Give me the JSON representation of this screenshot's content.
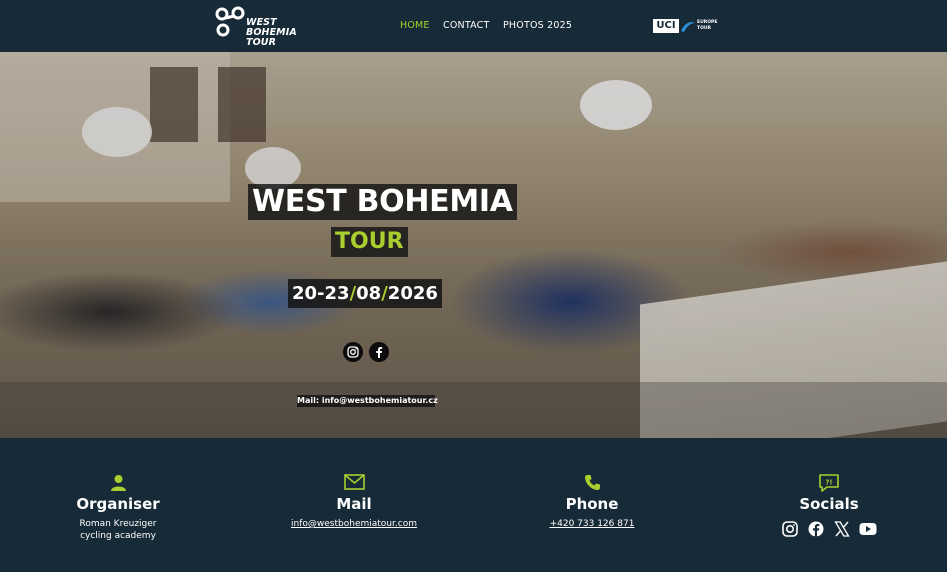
{
  "header": {
    "logo_lines": [
      "WEST",
      "BOHEMIA",
      "TOUR"
    ],
    "nav": [
      {
        "label": "HOME",
        "active": true
      },
      {
        "label": "CONTACT",
        "active": false
      },
      {
        "label": "PHOTOS 2025",
        "active": false
      }
    ],
    "uci_logo": {
      "text": "UCI",
      "sub_lines": [
        "EUROPE",
        "TOUR"
      ]
    }
  },
  "hero": {
    "title": "WEST BOHEMIA",
    "subtitle": "TOUR",
    "dates": {
      "day": "20-23",
      "month": "08",
      "year": "2026"
    },
    "social_icons": [
      "instagram-icon",
      "facebook-icon"
    ],
    "mail": "Mail: info@westbohemiatour.cz"
  },
  "footer": {
    "columns": [
      {
        "icon": "person-icon",
        "heading": "Organiser",
        "lines": [
          "Roman Kreuziger",
          "cycling academy"
        ]
      },
      {
        "icon": "envelope-icon",
        "heading": "Mail",
        "link": "info@westbohemiatour.com"
      },
      {
        "icon": "phone-icon",
        "heading": "Phone",
        "link": "+420 733 126 871"
      },
      {
        "icon": "chat-bubble-icon",
        "heading": "Socials",
        "social_icons": [
          "instagram-icon",
          "facebook-icon",
          "x-icon",
          "youtube-icon"
        ]
      }
    ]
  },
  "colors": {
    "navy": "#172a37",
    "accent_green": "#a8cf2e",
    "white": "#ffffff"
  }
}
